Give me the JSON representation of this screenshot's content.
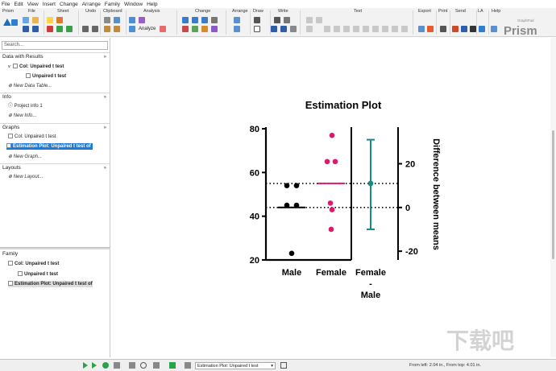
{
  "menu": [
    "File",
    "Edit",
    "View",
    "Insert",
    "Change",
    "Arrange",
    "Family",
    "Window",
    "Help"
  ],
  "ribbon": {
    "groups": [
      "Prism",
      "File",
      "Sheet",
      "Undo",
      "Clipboard",
      "Analysis",
      "Change",
      "Arrange",
      "Draw",
      "Write",
      "Text",
      "Export",
      "Print",
      "Send",
      "LA",
      "Help"
    ],
    "analyze_label": "Analyze",
    "logo_small": "GraphPad",
    "logo_big": "Prism"
  },
  "sidebar": {
    "search_placeholder": "Search...",
    "sections": {
      "data": {
        "title": "Data with Results",
        "table": "Col: Unpaired t test",
        "result": "Unpaired t test",
        "new": "New Data Table..."
      },
      "info": {
        "title": "Info",
        "item": "Project info 1",
        "new": "New Info..."
      },
      "graphs": {
        "title": "Graphs",
        "item1": "Col: Unpaired t test",
        "item2": "Estimation Plot: Unpaired t test of",
        "new": "New Graph..."
      },
      "layouts": {
        "title": "Layouts",
        "new": "New Layout..."
      }
    },
    "family": {
      "title": "Family",
      "item1": "Col: Unpaired t test",
      "item2": "Unpaired t test",
      "item3": "Estimation Plot: Unpaired t test of"
    }
  },
  "chart_data": {
    "type": "scatter",
    "title": "Estimation Plot",
    "left_axis": {
      "ylim": [
        20,
        80
      ],
      "ticks": [
        "20",
        "40",
        "60",
        "80"
      ]
    },
    "right_axis": {
      "label": "Difference between means",
      "ticks": [
        "-20",
        "0",
        "20"
      ]
    },
    "categories": [
      "Male",
      "Female",
      "Female - Male"
    ],
    "groups": [
      {
        "name": "Male",
        "color": "#000000",
        "points": [
          54,
          54,
          45,
          45,
          23
        ],
        "mean": 44
      },
      {
        "name": "Female",
        "color": "#e0166f",
        "points": [
          77,
          65,
          65,
          46,
          43,
          34
        ],
        "mean": 55
      }
    ],
    "difference": {
      "color": "#148a8a",
      "mean": 11,
      "ci_low": -10,
      "ci_high": 31
    },
    "reference_lines": {
      "style": "dotted",
      "values": [
        44,
        55
      ]
    }
  },
  "status": {
    "sheet_selector": "Estimation Plot: Unpaired t test",
    "position_text": "From left: 2.04 in., From top: 4.01 in."
  },
  "watermark": "下载吧"
}
